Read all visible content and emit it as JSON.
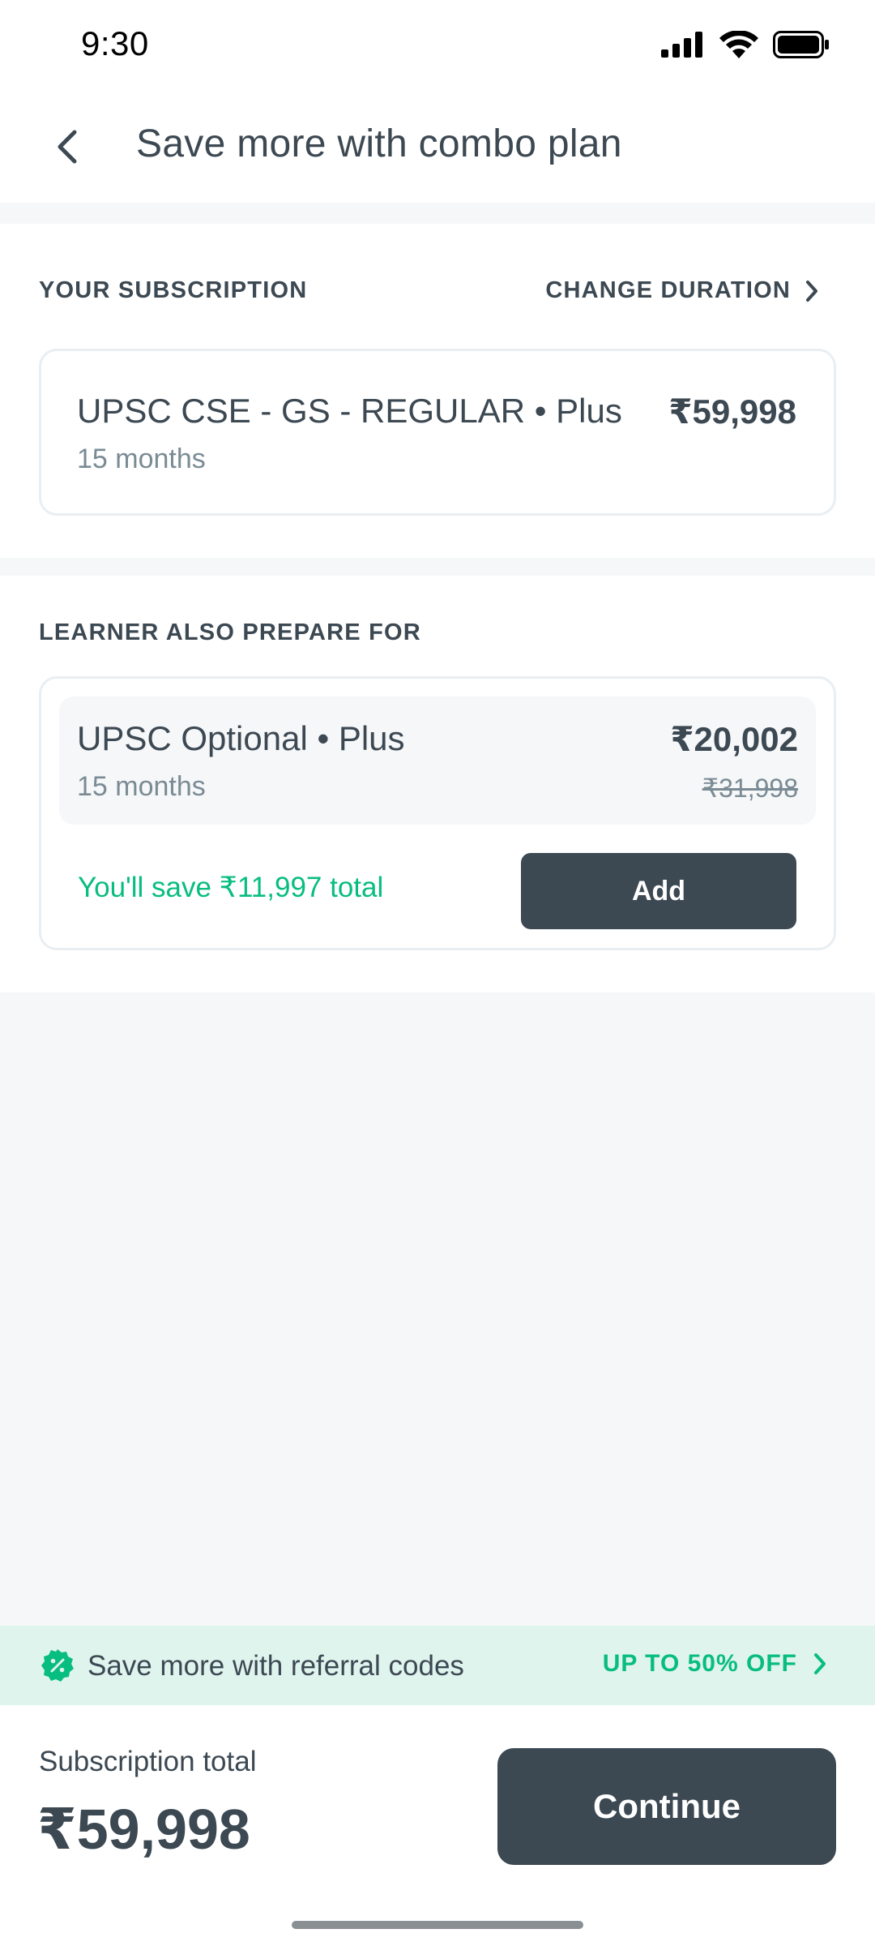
{
  "status_bar": {
    "time": "9:30"
  },
  "header": {
    "title": "Save more with combo plan"
  },
  "subscription": {
    "section_label": "YOUR SUBSCRIPTION",
    "change_label": "CHANGE DURATION",
    "plan_name": "UPSC CSE - GS - REGULAR • Plus",
    "duration": "15 months",
    "price": "₹59,998"
  },
  "also_prepare": {
    "section_label": "LEARNER ALSO PREPARE FOR",
    "plan_name": "UPSC Optional • Plus",
    "duration": "15 months",
    "price": "₹20,002",
    "original_price": "₹31,998",
    "savings_text": "You'll save ₹11,997 total",
    "add_label": "Add"
  },
  "referral": {
    "text": "Save more with referral codes",
    "offer": "UP TO 50% OFF"
  },
  "footer": {
    "total_label": "Subscription total",
    "total_amount": "₹59,998",
    "continue_label": "Continue"
  },
  "colors": {
    "text_primary": "#3c4852",
    "text_secondary": "#7a8b94",
    "accent_green": "#08bd80",
    "button_dark": "#3c4852",
    "background": "#f6f7f9"
  },
  "icons": [
    "back-arrow-icon",
    "chevron-right-icon",
    "discount-badge-icon",
    "signal-icon",
    "wifi-icon",
    "battery-icon"
  ]
}
